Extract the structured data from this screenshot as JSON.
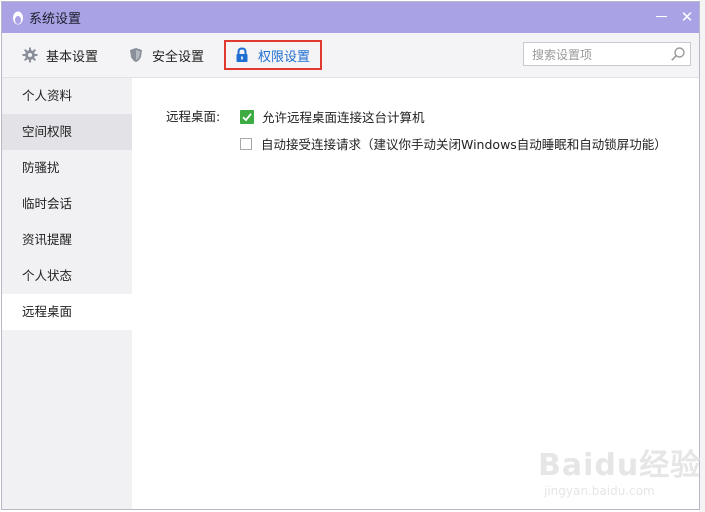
{
  "window": {
    "title": "系统设置",
    "minimize_symbol": "－",
    "close_symbol": "✕"
  },
  "toolbar": {
    "tabs": [
      {
        "label": "基本设置",
        "icon": "gear-icon"
      },
      {
        "label": "安全设置",
        "icon": "shield-icon"
      },
      {
        "label": "权限设置",
        "icon": "lock-icon",
        "active": true
      }
    ],
    "search_placeholder": "搜索设置项"
  },
  "sidebar": {
    "items": [
      {
        "label": "个人资料"
      },
      {
        "label": "空间权限",
        "state": "hover"
      },
      {
        "label": "防骚扰"
      },
      {
        "label": "临时会话"
      },
      {
        "label": "资讯提醒"
      },
      {
        "label": "个人状态"
      },
      {
        "label": "远程桌面",
        "state": "selected"
      }
    ]
  },
  "content": {
    "section_label": "远程桌面:",
    "options": [
      {
        "label": "允许远程桌面连接这台计算机",
        "checked": true
      },
      {
        "label": "自动接受连接请求（建议你手动关闭Windows自动睡眠和自动锁屏功能）",
        "checked": false
      }
    ]
  },
  "watermark": {
    "logo": "Baidu经验",
    "url": "jingyan.baidu.com"
  },
  "colors": {
    "titlebar": "#a9a3e6",
    "active_tab_text": "#1f6fd0",
    "active_tab_border": "#e03a2e",
    "checkbox_checked": "#3bab42",
    "sidebar_bg": "#f1f1f3"
  }
}
